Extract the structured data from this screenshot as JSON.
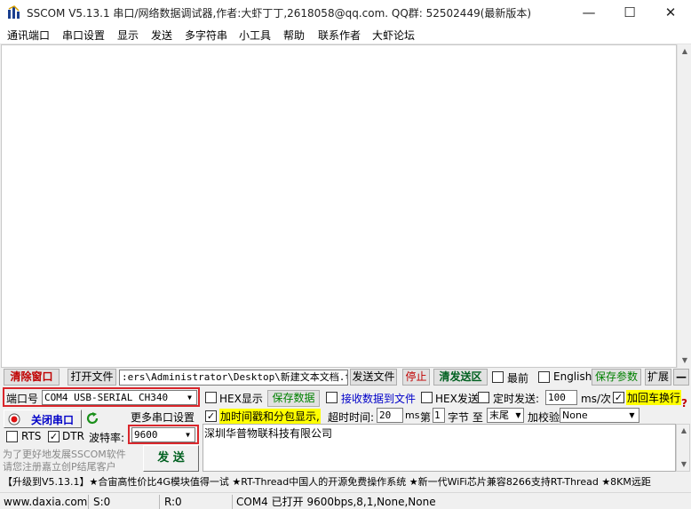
{
  "window": {
    "title": "SSCOM V5.13.1 串口/网络数据调试器,作者:大虾丁丁,2618058@qq.com. QQ群: 52502449(最新版本)"
  },
  "menu": [
    "通讯端口",
    "串口设置",
    "显示",
    "发送",
    "多字符串",
    "小工具",
    "帮助",
    "联系作者",
    "大虾论坛"
  ],
  "toolbar": {
    "clear_label": "清除窗口",
    "open_file_label": "打开文件",
    "file_path": ":ers\\Administrator\\Desktop\\新建文本文档.txt",
    "send_file_label": "发送文件",
    "stop_label": "停止",
    "clear_send_label": "清发送区",
    "top_label": "最前",
    "english_label": "English",
    "save_params_label": "保存参数",
    "expand_label": "扩展",
    "collapse_label": "—"
  },
  "port": {
    "port_label": "端口号",
    "port_value": "COM4 USB-SERIAL CH340",
    "close_label": "关闭串口",
    "more_settings_label": "更多串口设置",
    "rts_label": "RTS",
    "dtr_label": "DTR",
    "baud_label": "波特率:",
    "baud_value": "9600",
    "promo_line1": "为了更好地发展SSCOM软件",
    "promo_line2": "请您注册嘉立创P结尾客户"
  },
  "options": {
    "hex_display_label": "HEX显示",
    "save_data_label": "保存数据",
    "recv_to_file_label": "接收数据到文件",
    "hex_send_label": "HEX发送",
    "timed_send_label": "定时发送:",
    "interval_value": "100",
    "interval_unit": "ms/次",
    "add_crlf_label": "加回车换行",
    "timestamp_label": "加时间戳和分包显示,",
    "timeout_label": "超时时间:",
    "timeout_value": "20",
    "timeout_unit": "ms",
    "byte_label_1": "第",
    "byte_value": "1",
    "byte_label_2": "字节 至",
    "end_value": "末尾",
    "checksum_label": "加校验",
    "checksum_value": "None"
  },
  "send": {
    "text": "深圳华普物联科技有限公司",
    "send_label": "发 送"
  },
  "ticker": "【升级到V5.13.1】★合宙高性价比4G模块值得一试 ★RT-Thread中国人的开源免费操作系统 ★新一代WiFi芯片兼容8266支持RT-Thread ★8KM远距",
  "status": {
    "site": "www.daxia.com",
    "sent": "S:0",
    "received": "R:0",
    "port_state": "COM4 已打开  9600bps,8,1,None,None"
  }
}
